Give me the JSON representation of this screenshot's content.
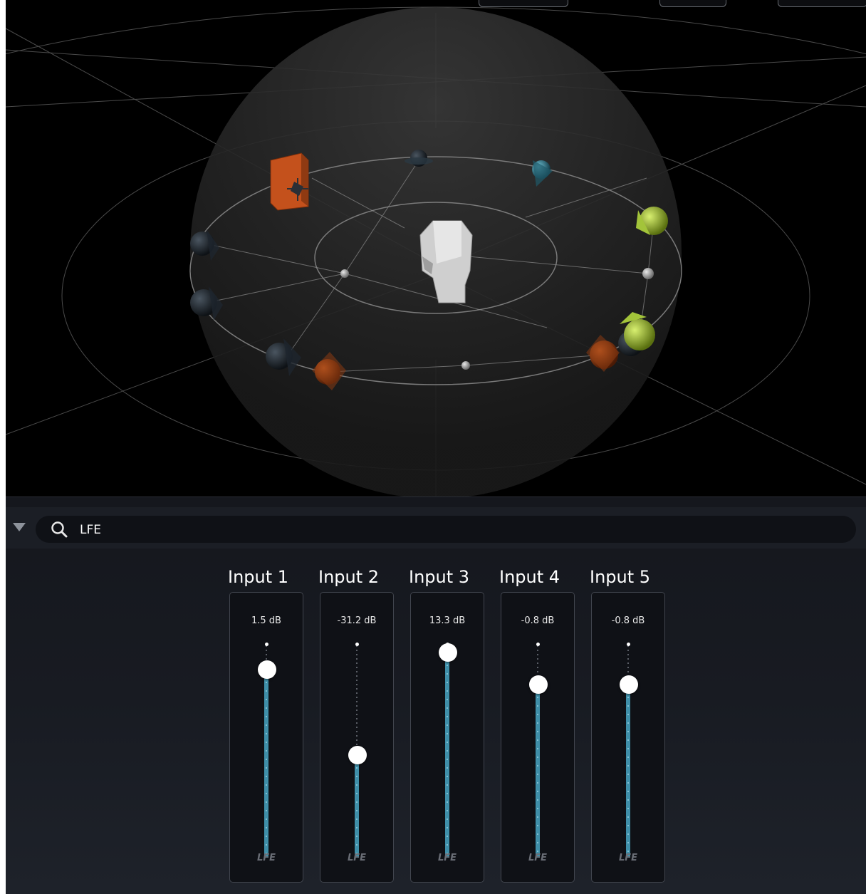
{
  "search": {
    "value": "LFE",
    "icon": "search-icon"
  },
  "colors": {
    "fader_fill": "#3f8fa9",
    "speaker_orange": "#c4511c",
    "source_green": "#a3c43a",
    "source_teal": "#3a8fa3"
  },
  "channels": [
    {
      "title": "Input 1",
      "db": "1.5 dB",
      "level": 0.88,
      "bus": "LFE"
    },
    {
      "title": "Input 2",
      "db": "-31.2 dB",
      "level": 0.48,
      "bus": "LFE"
    },
    {
      "title": "Input 3",
      "db": "13.3 dB",
      "level": 0.96,
      "bus": "LFE"
    },
    {
      "title": "Input 4",
      "db": "-0.8 dB",
      "level": 0.81,
      "bus": "LFE"
    },
    {
      "title": "Input 5",
      "db": "-0.8 dB",
      "level": 0.81,
      "bus": "LFE"
    }
  ]
}
